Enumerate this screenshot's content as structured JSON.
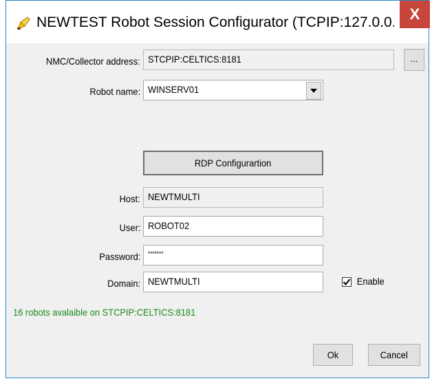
{
  "window": {
    "title": "NEWTEST Robot Session Configurator (TCPIP:127.0.0....",
    "close_glyph": "X"
  },
  "form": {
    "collector_label": "NMC/Collector address:",
    "collector_value": "STCPIP:CELTICS:8181",
    "browse_label": "...",
    "robot_label": "Robot name:",
    "robot_value": "WINSERV01",
    "rdp_button_label": "RDP Configurartion",
    "host_label": "Host:",
    "host_value": "NEWTMULTI",
    "user_label": "User:",
    "user_value": "ROBOT02",
    "password_label": "Password:",
    "password_value": "*******",
    "domain_label": "Domain:",
    "domain_value": "NEWTMULTI",
    "enable_label": "Enable",
    "enable_checked": true
  },
  "status": {
    "message": "16 robots avalaible on STCPIP:CELTICS:8181",
    "color": "#1b8a1b"
  },
  "buttons": {
    "ok_label": "Ok",
    "cancel_label": "Cancel"
  },
  "colors": {
    "close_button": "#c7463c",
    "window_border": "#2b86c7"
  }
}
